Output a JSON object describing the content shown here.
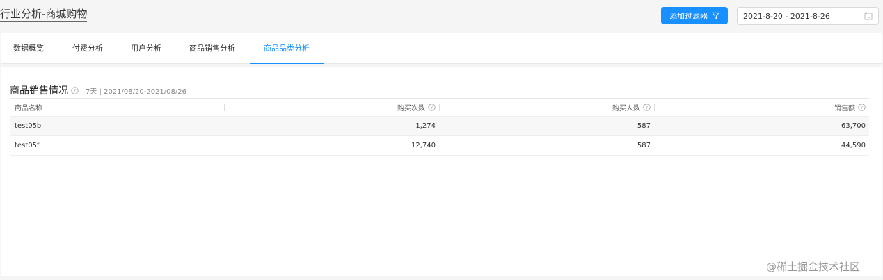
{
  "header": {
    "title": "行业分析-商城购物",
    "filter_button": "添加过滤器",
    "date_range": "2021-8-20 - 2021-8-26"
  },
  "tabs": [
    {
      "label": "数据概览"
    },
    {
      "label": "付费分析"
    },
    {
      "label": "用户分析"
    },
    {
      "label": "商品销售分析"
    },
    {
      "label": "商品品类分析",
      "active": true
    }
  ],
  "section": {
    "title": "商品销售情况",
    "subtitle": "7天 | 2021/08/20-2021/08/26"
  },
  "table": {
    "columns": [
      "商品名称",
      "购买次数",
      "购买人数",
      "销售额"
    ],
    "rows": [
      [
        "test05b",
        "1,274",
        "587",
        "63,700"
      ],
      [
        "test05f",
        "12,740",
        "587",
        "44,590"
      ]
    ]
  },
  "watermark": "@稀土掘金技术社区",
  "colors": {
    "accent": "#1890ff"
  }
}
